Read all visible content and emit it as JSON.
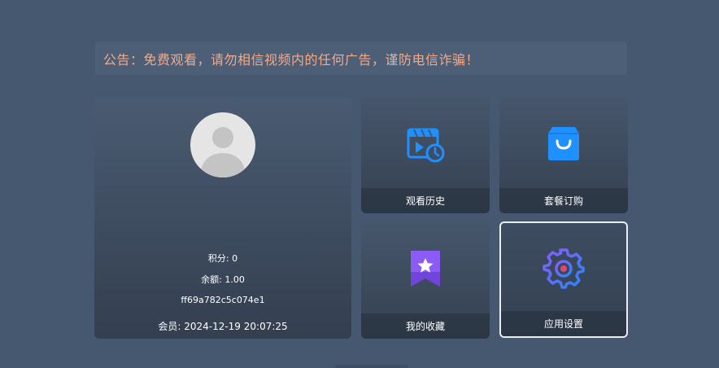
{
  "notice": {
    "text": "公告：免费观看，请勿相信视频内的任何广告，谨防电信诈骗！"
  },
  "profile": {
    "points": "积分: 0",
    "balance": "余额: 1.00",
    "device_id": "ff69a782c5c074e1",
    "membership": "会员: 2024-12-19 20:07:25"
  },
  "tiles": [
    {
      "label": "观看历史",
      "icon": "watch-history-icon"
    },
    {
      "label": "套餐订购",
      "icon": "shopping-bag-icon"
    },
    {
      "label": "我的收藏",
      "icon": "favorites-star-icon"
    },
    {
      "label": "应用设置",
      "icon": "settings-gear-icon"
    }
  ],
  "colors": {
    "background": "#455870",
    "notice_text": "#f2a98a",
    "accent_blue": "#1e90ff",
    "accent_purple": "#8a5cf5",
    "focus_border": "#e9edf2"
  }
}
